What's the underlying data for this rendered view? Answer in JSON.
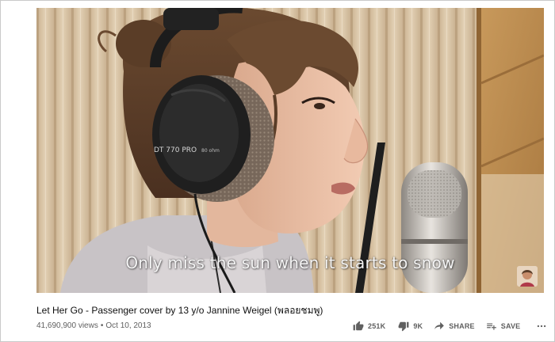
{
  "video": {
    "subtitle": "Only miss the sun when it starts to snow",
    "headphone_brand": "DT 770 PRO",
    "headphone_model": "80 ohm"
  },
  "info": {
    "title": "Let Her Go - Passenger cover by 13 y/o Jannine Weigel (พลอยชมพู)",
    "views": "41,690,900 views",
    "separator": "•",
    "date": "Oct 10, 2013"
  },
  "actions": {
    "like": {
      "label": "251K",
      "icon": "thumb-up-icon"
    },
    "dislike": {
      "label": "9K",
      "icon": "thumb-down-icon"
    },
    "share": {
      "label": "SHARE",
      "icon": "share-arrow-icon"
    },
    "save": {
      "label": "SAVE",
      "icon": "playlist-add-icon"
    },
    "more": {
      "icon": "more-horizontal-icon"
    }
  },
  "colors": {
    "text_primary": "#0f0f0f",
    "text_secondary": "#606060",
    "subtitle": "#f4f4f4"
  }
}
